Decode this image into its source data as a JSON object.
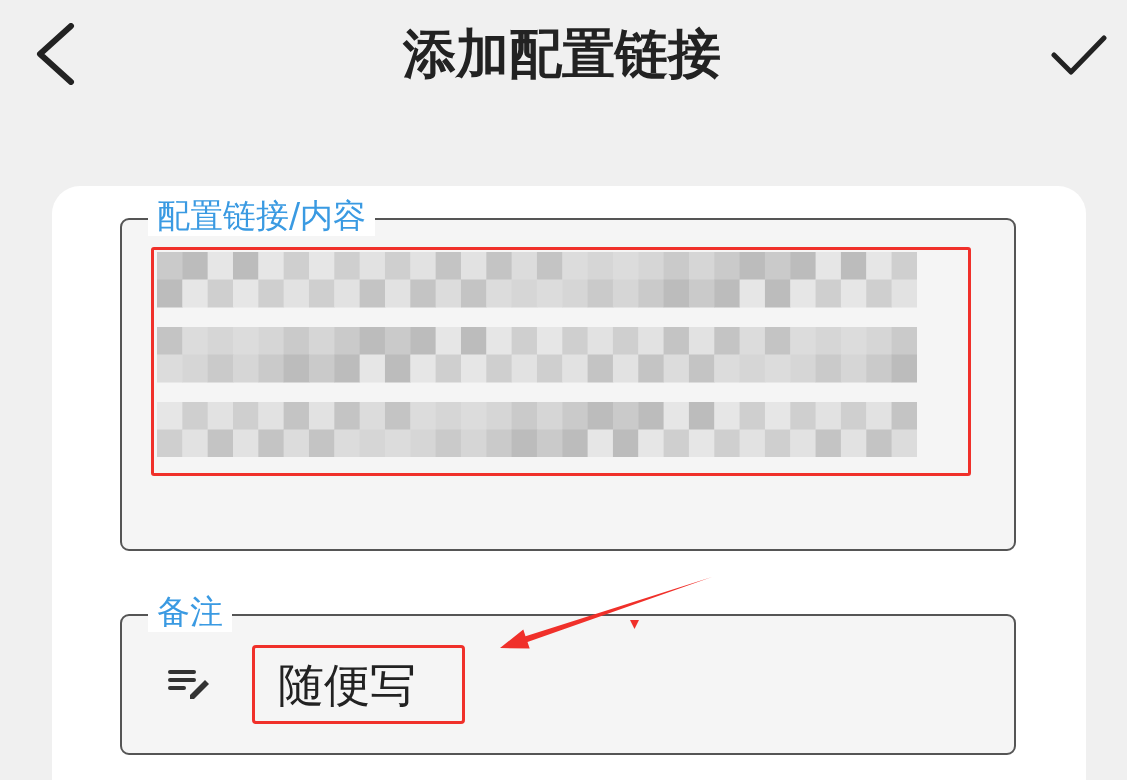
{
  "header": {
    "title": "添加配置链接"
  },
  "fields": [
    {
      "kind": "redacted",
      "label": "配置链接/内容"
    },
    {
      "kind": "note",
      "label": "备注",
      "value": "随便写"
    }
  ]
}
